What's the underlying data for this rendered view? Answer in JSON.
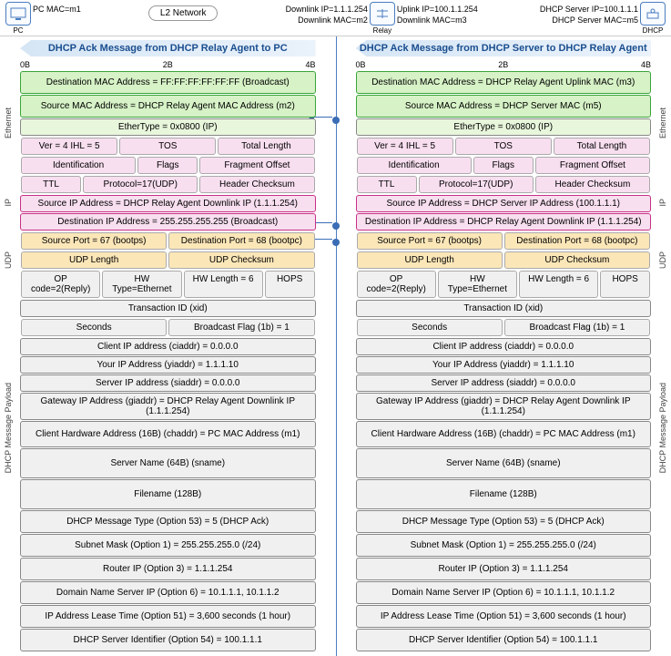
{
  "top": {
    "pc_mac": "PC MAC=m1",
    "l2": "L2 Network",
    "dl_ip": "Downlink IP=1.1.1.254",
    "dl_mac": "Downlink MAC=m2",
    "relay": "Relay",
    "ul_ip": "Uplink IP=100.1.1.254",
    "ul_mac": "Downlink MAC=m3",
    "srv_ip": "DHCP Server IP=100.1.1.1",
    "srv_mac": "DHCP Server MAC=m5",
    "pc": "PC",
    "dhcp": "DHCP"
  },
  "h": {
    "left": "DHCP Ack Message from DHCP Relay Agent to PC",
    "right": "DHCP Ack Message from DHCP Server to DHCP Relay Agent"
  },
  "ruler": {
    "a": "0B",
    "b": "2B",
    "c": "4B"
  },
  "side": {
    "eth": "Ethernet",
    "ip": "IP",
    "udp": "UDP",
    "pl": "DHCP Message Payload"
  },
  "L": {
    "eth_d": "Destination MAC Address = FF:FF:FF:FF:FF:FF (Broadcast)",
    "eth_s": "Source MAC Address = DHCP Relay Agent MAC Address (m2)",
    "eth_t": "EtherType = 0x0800 (IP)",
    "ip1a": "Ver = 4   IHL = 5",
    "ip1b": "TOS",
    "ip1c": "Total Length",
    "ip2a": "Identification",
    "ip2b": "Flags",
    "ip2c": "Fragment Offset",
    "ip3a": "TTL",
    "ip3b": "Protocol=17(UDP)",
    "ip3c": "Header Checksum",
    "ip_s": "Source IP Address = DHCP Relay Agent Downlink IP (1.1.1.254)",
    "ip_d": "Destination IP Address = 255.255.255.255 (Broadcast)",
    "udp_a": "Source Port = 67 (bootps)",
    "udp_b": "Destination Port = 68 (bootpc)",
    "udp_c": "UDP Length",
    "udp_d": "UDP Checksum",
    "p1a": "OP code=2(Reply)",
    "p1b": "HW Type=Ethernet",
    "p1c": "HW Length = 6",
    "p1d": "HOPS",
    "p2": "Transaction ID (xid)",
    "p3a": "Seconds",
    "p3b": "Broadcast Flag (1b) = 1",
    "p4": "Client IP address (ciaddr) = 0.0.0.0",
    "p5": "Your IP Address (yiaddr) = 1.1.1.10",
    "p6": "Server IP address (siaddr) = 0.0.0.0",
    "p7": "Gateway IP Address (giaddr) = DHCP Relay Agent Downlink IP (1.1.1.254)",
    "p8": "Client Hardware Address (16B) (chaddr) = PC MAC Address (m1)",
    "p9": "Server Name (64B) (sname)",
    "p10": "Filename (128B)",
    "p11": "DHCP Message Type (Option 53) = 5 (DHCP Ack)",
    "p12": "Subnet Mask (Option 1) = 255.255.255.0 (/24)",
    "p13": "Router IP (Option 3) = 1.1.1.254",
    "p14": "Domain Name Server IP (Option 6) = 10.1.1.1, 10.1.1.2",
    "p15": "IP Address Lease Time (Option 51) = 3,600 seconds (1 hour)",
    "p16": "DHCP Server Identifier (Option 54) = 100.1.1.1"
  },
  "R": {
    "eth_d": "Destination MAC Address = DHCP Relay Agent Uplink MAC (m3)",
    "eth_s": "Source MAC Address = DHCP Server MAC (m5)",
    "eth_t": "EtherType = 0x0800 (IP)",
    "ip1a": "Ver = 4   IHL = 5",
    "ip1b": "TOS",
    "ip1c": "Total Length",
    "ip2a": "Identification",
    "ip2b": "Flags",
    "ip2c": "Fragment Offset",
    "ip3a": "TTL",
    "ip3b": "Protocol=17(UDP)",
    "ip3c": "Header Checksum",
    "ip_s": "Source IP Address = DHCP Server IP Address (100.1.1.1)",
    "ip_d": "Destination IP Address = DHCP Relay Agent Downlink IP (1.1.1.254)",
    "udp_a": "Source Port = 67 (bootps)",
    "udp_b": "Destination Port = 68 (bootpc)",
    "udp_c": "UDP Length",
    "udp_d": "UDP Checksum",
    "p1a": "OP code=2(Reply)",
    "p1b": "HW Type=Ethernet",
    "p1c": "HW Length = 6",
    "p1d": "HOPS",
    "p2": "Transaction ID (xid)",
    "p3a": "Seconds",
    "p3b": "Broadcast Flag (1b) = 1",
    "p4": "Client IP address (ciaddr) = 0.0.0.0",
    "p5": "Your IP Address (yiaddr) = 1.1.1.10",
    "p6": "Server IP address (siaddr) = 0.0.0.0",
    "p7": "Gateway IP Address (giaddr) = DHCP Relay Agent Downlink IP (1.1.1.254)",
    "p8": "Client Hardware Address (16B) (chaddr) = PC MAC Address (m1)",
    "p9": "Server Name (64B) (sname)",
    "p10": "Filename (128B)",
    "p11": "DHCP Message Type (Option 53) = 5 (DHCP Ack)",
    "p12": "Subnet Mask (Option 1) = 255.255.255.0 (/24)",
    "p13": "Router IP (Option 3) = 1.1.1.254",
    "p14": "Domain Name Server IP (Option 6) = 10.1.1.1, 10.1.1.2",
    "p15": "IP Address Lease Time (Option 51) = 3,600 seconds (1 hour)",
    "p16": "DHCP Server Identifier (Option 54) = 100.1.1.1"
  }
}
